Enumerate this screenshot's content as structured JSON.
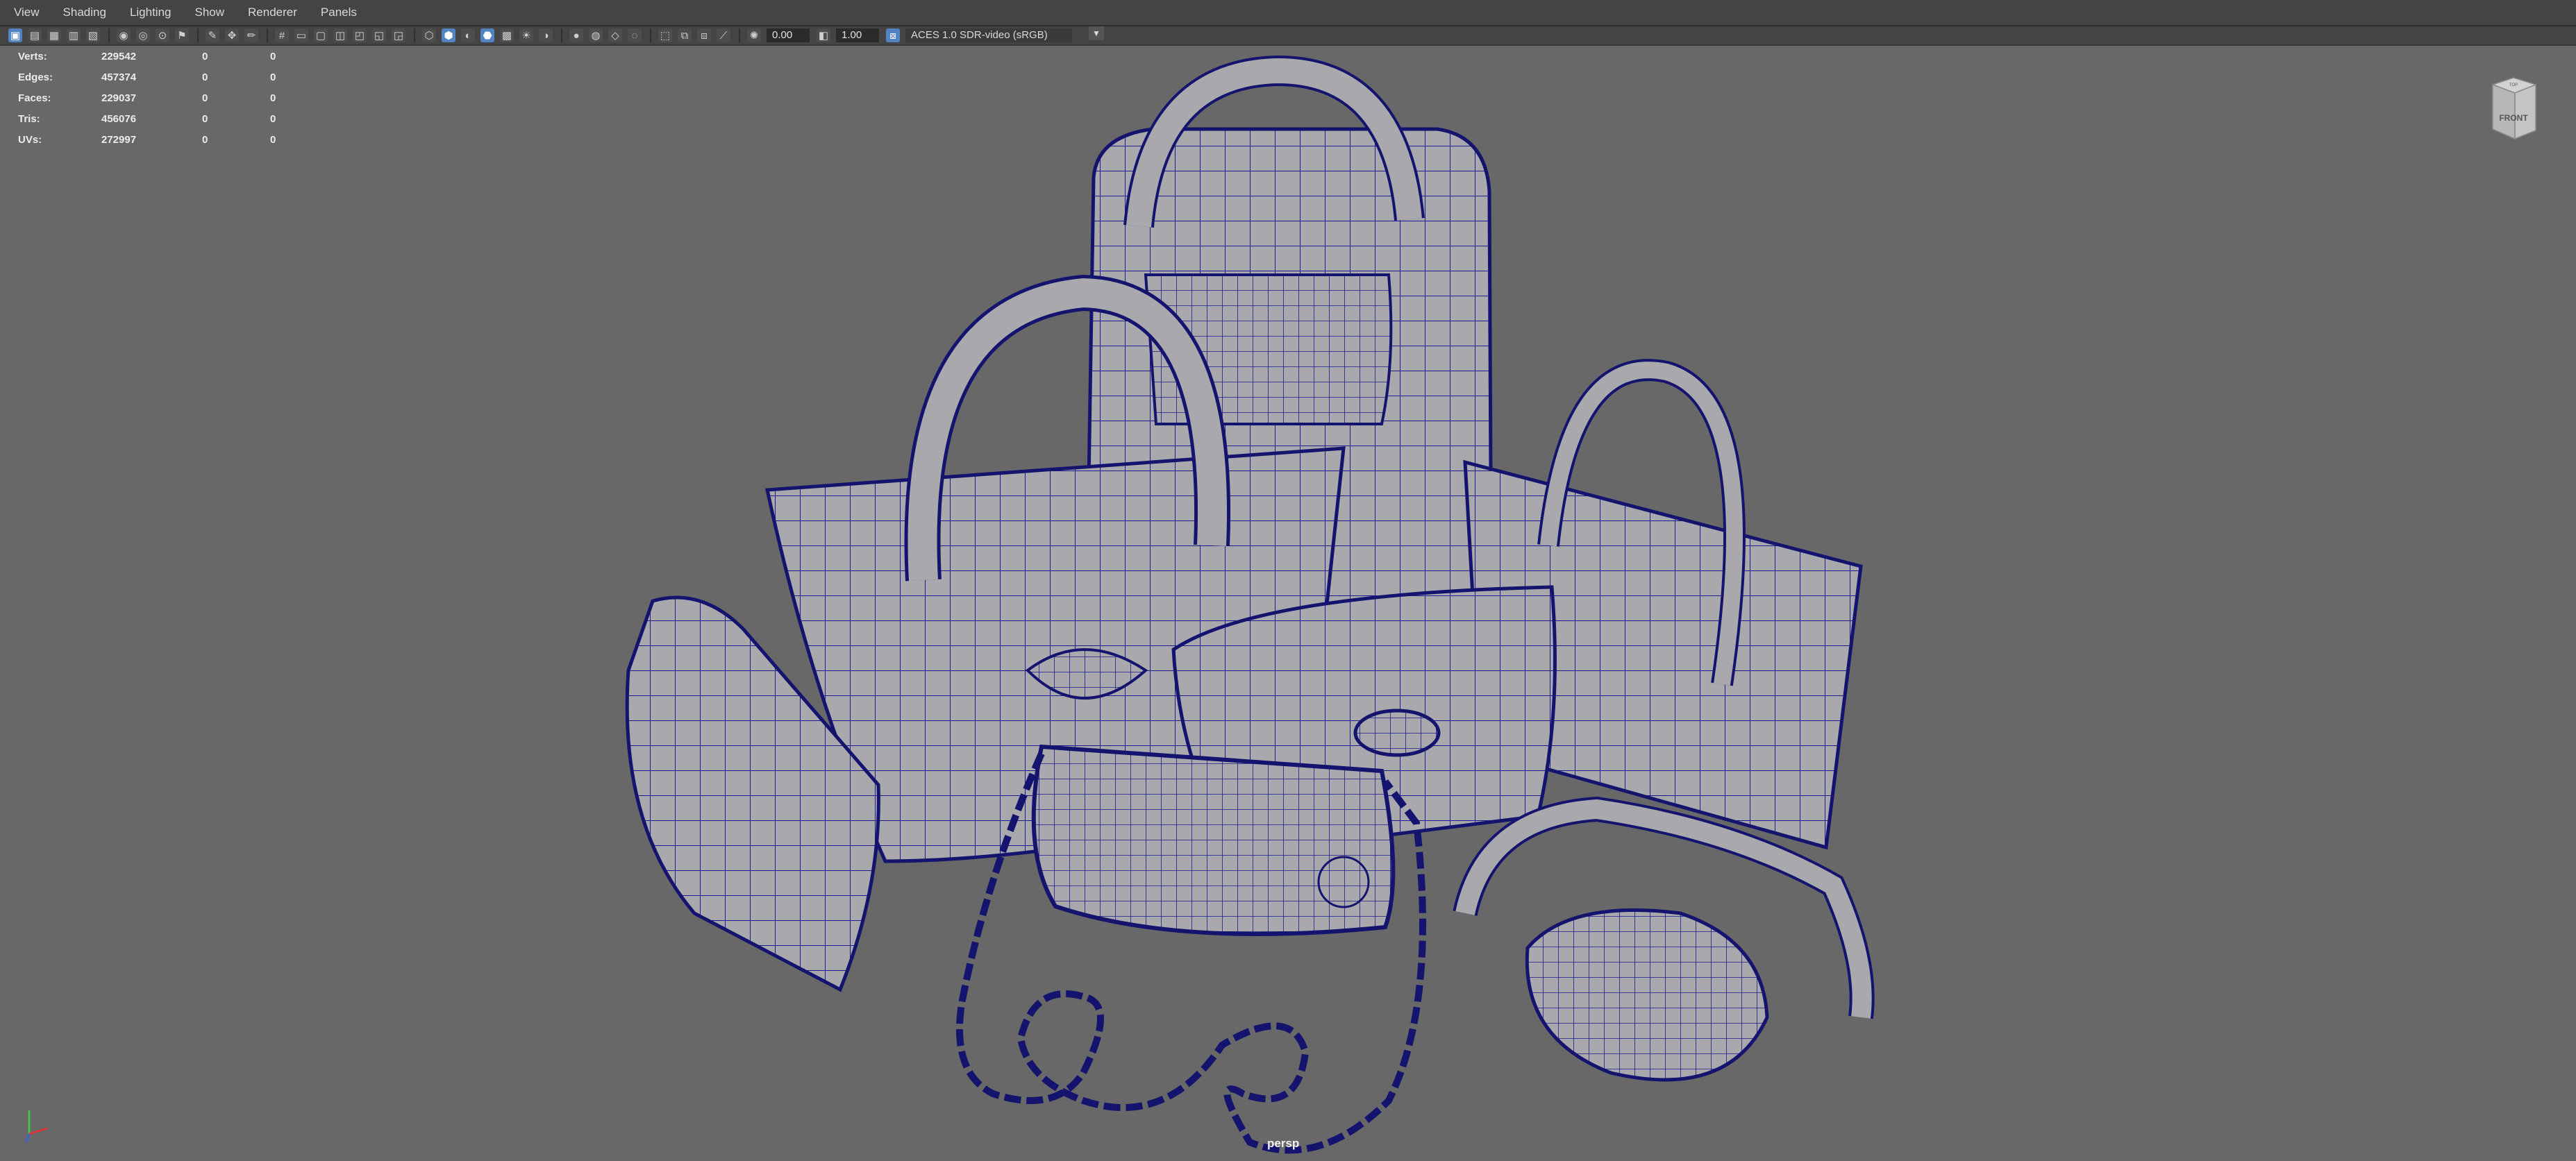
{
  "menu": [
    "View",
    "Shading",
    "Lighting",
    "Show",
    "Renderer",
    "Panels"
  ],
  "toolbar": {
    "exposure_value": "0.00",
    "gamma_value": "1.00",
    "colorspace_label": "ACES 1.0 SDR-video (sRGB)"
  },
  "hud": {
    "rows": [
      {
        "label": "Verts:",
        "v1": "229542",
        "v2": "0",
        "v3": "0"
      },
      {
        "label": "Edges:",
        "v1": "457374",
        "v2": "0",
        "v3": "0"
      },
      {
        "label": "Faces:",
        "v1": "229037",
        "v2": "0",
        "v3": "0"
      },
      {
        "label": "Tris:",
        "v1": "456076",
        "v2": "0",
        "v3": "0"
      },
      {
        "label": "UVs:",
        "v1": "272997",
        "v2": "0",
        "v3": "0"
      }
    ]
  },
  "viewcube": {
    "top_label": "TOP",
    "front_label": "FRONT"
  },
  "camera_label": "persp",
  "colors": {
    "viewport_bg": "#686868",
    "wire": "#1c1c8c",
    "mesh_fill": "#a9a9ad",
    "accent": "#5284c2"
  }
}
